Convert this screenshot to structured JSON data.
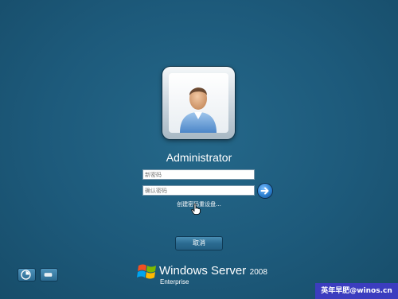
{
  "user": {
    "name": "Administrator"
  },
  "fields": {
    "new_password": {
      "placeholder": "新密码",
      "value": ""
    },
    "confirm_password": {
      "placeholder": "确认密码",
      "value": ""
    }
  },
  "links": {
    "reset_disk": "创建密码重设盘..."
  },
  "buttons": {
    "cancel": "取消"
  },
  "logo": {
    "main": "Windows Server",
    "version": "2008",
    "edition": "Enterprise"
  },
  "watermark": {
    "text": "英年早肥@winos.cn"
  },
  "colors": {
    "background": "#1c5878",
    "accent_button": "#2b6b91",
    "watermark_bg": "#3c3dbf"
  },
  "icons": {
    "go": "arrow-right-icon",
    "ease_of_access": "ease-of-access-icon",
    "power": "shutdown-icon",
    "user": "user-silhouette-icon",
    "windows": "windows-flag-icon"
  }
}
